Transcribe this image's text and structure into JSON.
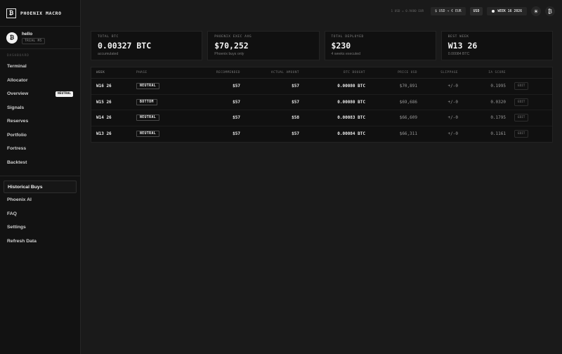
{
  "brand": {
    "logo_glyph": "₿",
    "name": "PHOENIX MACRO"
  },
  "user": {
    "avatar_glyph": "₿",
    "name": "hello",
    "plan": "TRIAL M5"
  },
  "sidebar": {
    "section_label": "DASHBOARD",
    "items": [
      {
        "label": "Terminal"
      },
      {
        "label": "Allocator"
      },
      {
        "label": "Overview",
        "badge": "NEUTRAL"
      },
      {
        "label": "Signals"
      },
      {
        "label": "Reserves"
      },
      {
        "label": "Portfolio"
      },
      {
        "label": "Fortress"
      },
      {
        "label": "Backtest"
      }
    ],
    "bottom_items": [
      {
        "label": "Historical Buys",
        "active": true
      },
      {
        "label": "Phoenix AI"
      },
      {
        "label": "FAQ"
      },
      {
        "label": "Settings"
      },
      {
        "label": "Refresh Data"
      }
    ]
  },
  "topbar": {
    "rate_info": "1 USD = 0.9480 EUR",
    "currency_pair": "$ USD → € EUR",
    "currency": "USD",
    "week": "WEEK 16 2026",
    "theme_icon": "sun-icon",
    "account_icon": "bitcoin-icon",
    "theme_glyph": "☀",
    "account_glyph": "₿"
  },
  "stats": [
    {
      "label": "TOTAL BTC",
      "value": "0.00327 BTC",
      "sub": "accumulated"
    },
    {
      "label": "PHOENIX EXEC AVG",
      "value": "$70,252",
      "sub": "Phoenix buys only"
    },
    {
      "label": "TOTAL DEPLOYED",
      "value": "$230",
      "sub": "4 weeks executed"
    },
    {
      "label": "BEST WEEK",
      "value": "W13 26",
      "sub": "0.00084 BTC"
    }
  ],
  "table": {
    "headers": [
      "WEEK",
      "PHASE",
      "RECOMMENDED",
      "ACTUAL AMOUNT",
      "BTC BOUGHT",
      "PRICE USD",
      "SLIPPAGE",
      "IA SCORE",
      ""
    ],
    "rows": [
      {
        "week": "W16 26",
        "phase": "NEUTRAL",
        "recommended": "$57",
        "actual": "$57",
        "btc": "0.00080 BTC",
        "price": "$70,891",
        "slippage": "+/-0",
        "score": "0.1995",
        "action": "EDIT"
      },
      {
        "week": "W15 26",
        "phase": "BOTTOM",
        "recommended": "$57",
        "actual": "$57",
        "btc": "0.00080 BTC",
        "price": "$69,686",
        "slippage": "+/-0",
        "score": "0.0320",
        "action": "EDIT"
      },
      {
        "week": "W14 26",
        "phase": "NEUTRAL",
        "recommended": "$57",
        "actual": "$58",
        "btc": "0.00083 BTC",
        "price": "$66,609",
        "slippage": "+/-0",
        "score": "0.1795",
        "action": "EDIT"
      },
      {
        "week": "W13 26",
        "phase": "NEUTRAL",
        "recommended": "$57",
        "actual": "$57",
        "btc": "0.00084 BTC",
        "price": "$66,311",
        "slippage": "+/-0",
        "score": "0.1161",
        "action": "EDIT"
      }
    ]
  }
}
